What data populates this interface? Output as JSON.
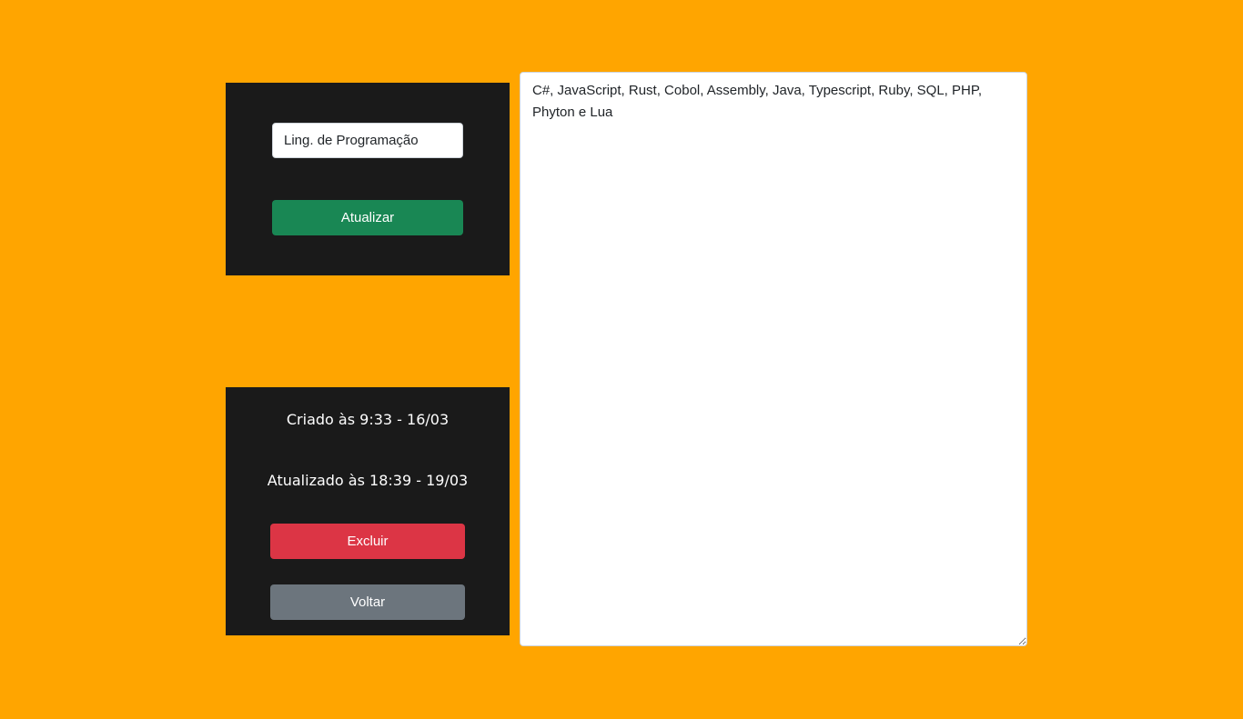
{
  "editor": {
    "title_value": "Ling. de Programação",
    "update_label": "Atualizar",
    "content": "C#, JavaScript, Rust, Cobol, Assembly, Java, Typescript, Ruby, SQL, PHP, Phyton e Lua"
  },
  "meta": {
    "created": "Criado às 9:33 - 16/03",
    "updated": "Atualizado às 18:39 - 19/03"
  },
  "actions": {
    "delete_label": "Excluir",
    "back_label": "Voltar"
  },
  "colors": {
    "background": "#ffa500",
    "panel": "#1a1a1a",
    "update": "#198754",
    "delete": "#dc3545",
    "back": "#6c757d"
  }
}
